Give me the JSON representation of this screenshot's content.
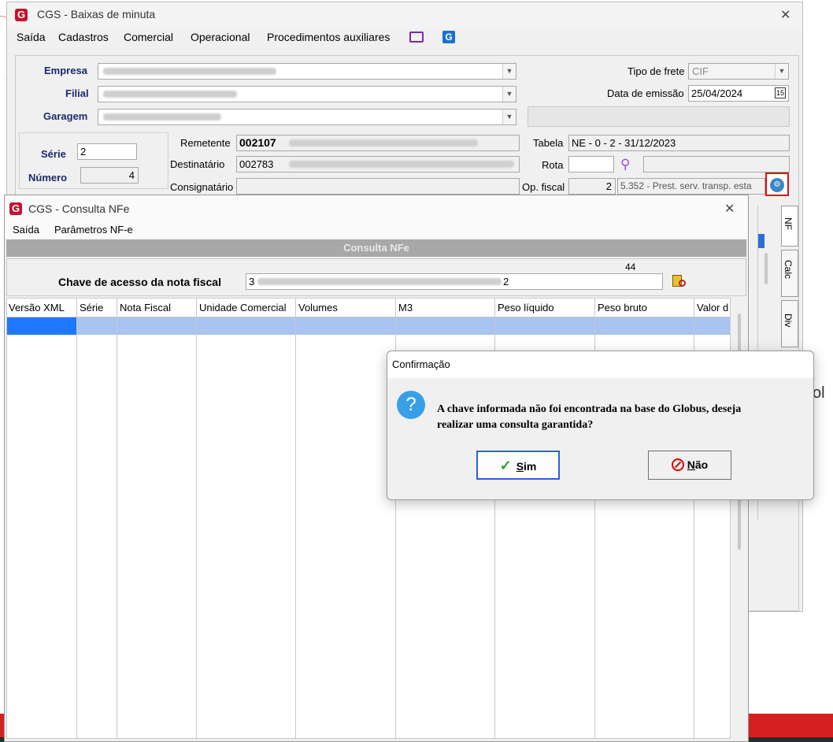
{
  "main_window": {
    "title": "CGS - Baixas de minuta",
    "close": "✕",
    "menu": [
      "Saída",
      "Cadastros",
      "Comercial",
      "Operacional",
      "Procedimentos auxiliares"
    ],
    "labels": {
      "empresa": "Empresa",
      "filial": "Filial",
      "garagem": "Garagem",
      "serie": "Série",
      "numero": "Número",
      "remetente": "Remetente",
      "destinatario": "Destinatário",
      "consignatario": "Consignatário",
      "tipo_frete": "Tipo de frete",
      "data_emissao": "Data de emissão",
      "tabela": "Tabela",
      "rota": "Rota",
      "op_fiscal": "Op. fiscal"
    },
    "values": {
      "serie": "2",
      "numero": "4",
      "remetente_code": "002107",
      "destinatario_code": "002783",
      "tipo_frete": "CIF",
      "data_emissao": "25/04/2024",
      "tabela": "NE - 0 - 2 - 31/12/2023",
      "op_fiscal_num": "2",
      "op_fiscal_desc": "5.352 - Prest. serv. transp. esta"
    },
    "tabs": [
      "NF",
      "Calc",
      "Div"
    ]
  },
  "nfe_window": {
    "title": "CGS - Consulta NFe",
    "close": "✕",
    "menu": [
      "Saída",
      "Parâmetros NF-e"
    ],
    "section_header": "Consulta NFe",
    "key_label": "Chave de acesso da nota fiscal",
    "key_value_start": "3",
    "key_value_end": "2",
    "key_length": "44",
    "columns": [
      "Versão XML",
      "Série",
      "Nota Fiscal",
      "Unidade Comercial",
      "Volumes",
      "M3",
      "Peso líquido",
      "Peso bruto",
      "Valor d"
    ]
  },
  "dialog": {
    "title": "Confirmação",
    "message_line1": "A chave informada não foi encontrada na base do Globus, deseja",
    "message_line2": "realizar uma consulta garantida?",
    "yes_rest": "im",
    "yes_key": "S",
    "no_rest": "ão",
    "no_key": "N"
  },
  "background": {
    "partial_text": "ol"
  },
  "colors": {
    "brand_red": "#c8102e",
    "selection_blue": "#1e78ff",
    "row_highlight": "#a8c4f0",
    "dialog_icon": "#39a0e8"
  }
}
